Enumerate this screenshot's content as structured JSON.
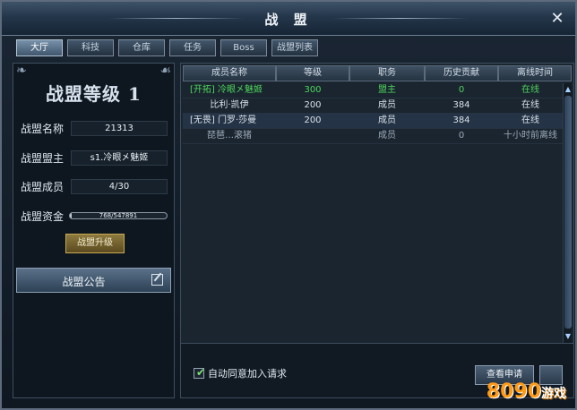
{
  "window": {
    "title": "战 盟",
    "close_label": "✕"
  },
  "tabs": [
    {
      "label": "大厅",
      "active": true
    },
    {
      "label": "科技",
      "active": false
    },
    {
      "label": "仓库",
      "active": false
    },
    {
      "label": "任务",
      "active": false
    },
    {
      "label": "Boss",
      "active": false
    },
    {
      "label": "战盟列表",
      "active": false
    }
  ],
  "info": {
    "level_title": "战盟等级 1",
    "name_label": "战盟名称",
    "name_value": "21313",
    "leader_label": "战盟盟主",
    "leader_value": "s1.冷眼㐅魅姬",
    "members_label": "战盟成员",
    "members_value": "4/30",
    "funds_label": "战盟资金",
    "funds_value": "768/547891",
    "funds_progress": 0.0014,
    "upgrade_label": "战盟升级",
    "notice_label": "战盟公告"
  },
  "table": {
    "headers": [
      "成员名称",
      "等级",
      "职务",
      "历史贡献",
      "离线时间"
    ],
    "rows": [
      [
        "[开拓] 冷眼㐅魅姬",
        "300",
        "盟主",
        "0",
        "在线"
      ],
      [
        "比利·凯伊",
        "200",
        "成员",
        "384",
        "在线"
      ],
      [
        "[无畏] 门罗·莎曼",
        "200",
        "成员",
        "384",
        "在线"
      ],
      [
        "琵琶…滚猪",
        "",
        "成员",
        "0",
        "十小时前离线"
      ]
    ]
  },
  "footer": {
    "auto_accept_label": "自动同意加入请求",
    "auto_accept_checked": true,
    "view_requests_label": "查看申请"
  },
  "watermark": {
    "brand": "8090",
    "suffix": "游戏"
  },
  "colors": {
    "leader_green": "#4fd55a",
    "accent_gold": "#c8a951",
    "brand_orange": "#ff9b16"
  }
}
